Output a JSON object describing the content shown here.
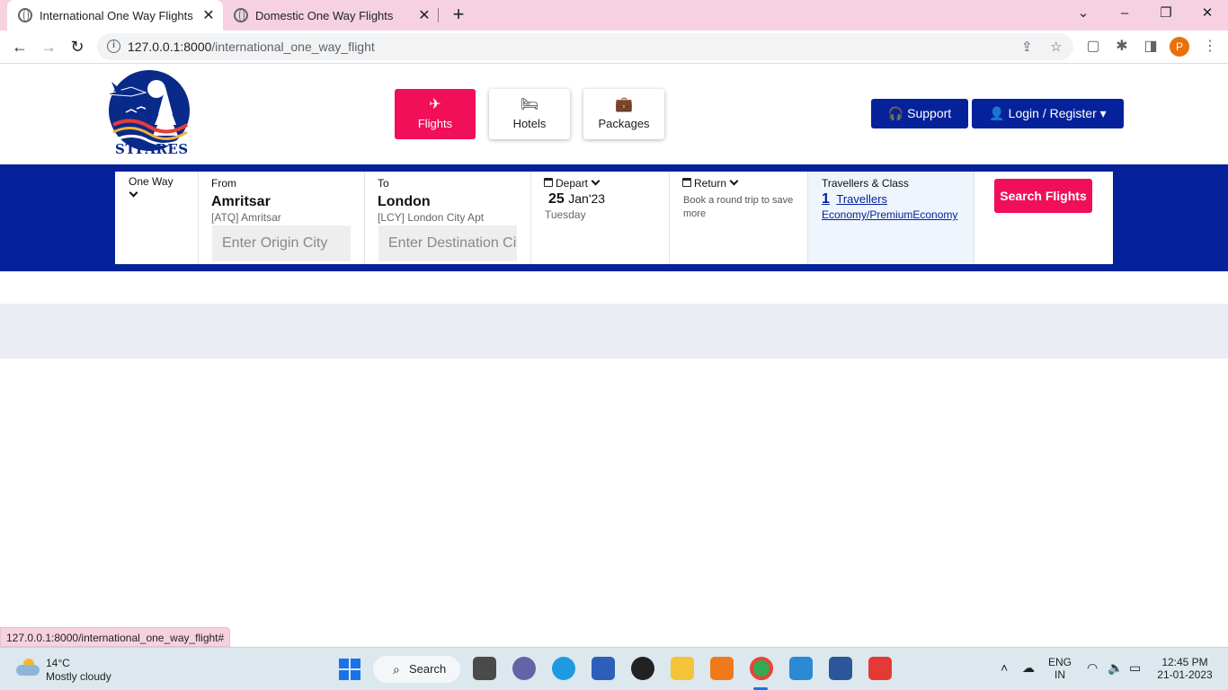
{
  "browser": {
    "tabs": [
      {
        "title": "International One Way Flights",
        "active": true
      },
      {
        "title": "Domestic One Way Flights",
        "active": false
      }
    ],
    "url_host": "127.0.0.1:8000",
    "url_path": "/international_one_way_flight",
    "profile_initial": "P",
    "status_url": "127.0.0.1:8000/international_one_way_flight#"
  },
  "site": {
    "logo_text": "STFARES",
    "categories": [
      {
        "label": "Flights",
        "icon": "plane-icon",
        "active": true
      },
      {
        "label": "Hotels",
        "icon": "bed-icon",
        "active": false
      },
      {
        "label": "Packages",
        "icon": "suitcase-icon",
        "active": false
      }
    ],
    "support_label": "Support",
    "login_label": "Login / Register"
  },
  "search": {
    "trip_type": "One Way",
    "from": {
      "label": "From",
      "city": "Amritsar",
      "airport": "[ATQ] Amritsar",
      "placeholder": "Enter Origin City"
    },
    "to": {
      "label": "To",
      "city": "London",
      "airport": "[LCY] London City Apt",
      "placeholder": "Enter Destination City"
    },
    "depart": {
      "label": "Depart",
      "day": "25",
      "month_year": "Jan'23",
      "weekday": "Tuesday"
    },
    "return": {
      "label": "Return",
      "note": "Book a round trip to save more"
    },
    "travellers": {
      "label": "Travellers & Class",
      "count": "1",
      "count_label": "Travellers",
      "class": "Economy/PremiumEconomy"
    },
    "search_label": "Search Flights"
  },
  "taskbar": {
    "weather_temp": "14°C",
    "weather_desc": "Mostly cloudy",
    "search_label": "Search",
    "lang_1": "ENG",
    "lang_2": "IN",
    "time": "12:45 PM",
    "date": "21-01-2023"
  },
  "colors": {
    "brand_blue": "#05229a",
    "accent_pink": "#f00f58",
    "tab_strip": "#f6d2e0"
  }
}
